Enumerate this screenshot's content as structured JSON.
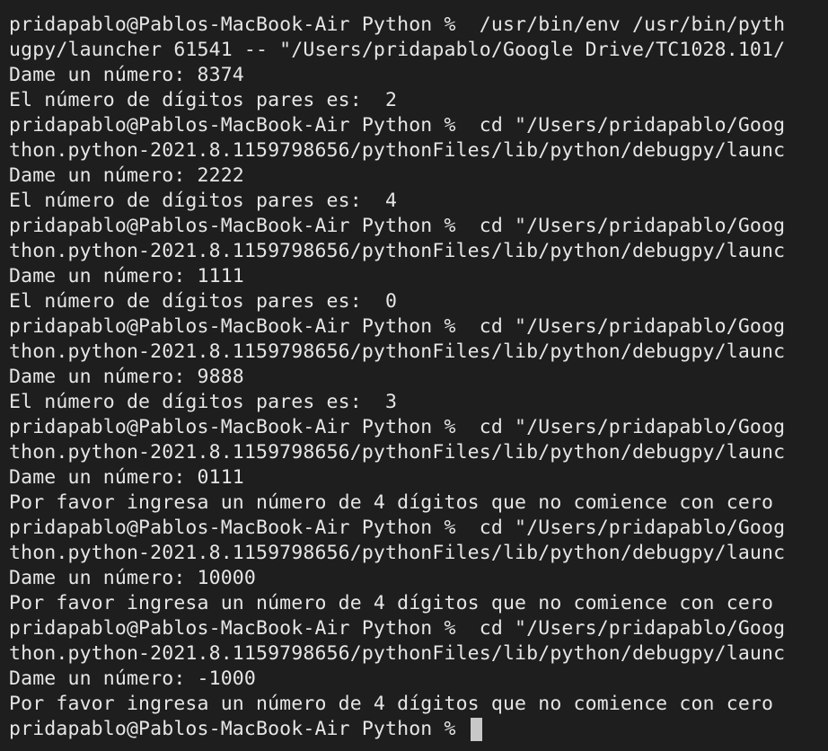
{
  "terminal": {
    "lines": [
      "pridapablo@Pablos-MacBook-Air Python %  /usr/bin/env /usr/bin/pyth",
      "ugpy/launcher 61541 -- \"/Users/pridapablo/Google Drive/TC1028.101/",
      "Dame un número: 8374",
      "El número de dígitos pares es:  2",
      "pridapablo@Pablos-MacBook-Air Python %  cd \"/Users/pridapablo/Goog",
      "thon.python-2021.8.1159798656/pythonFiles/lib/python/debugpy/launc",
      "Dame un número: 2222",
      "El número de dígitos pares es:  4",
      "pridapablo@Pablos-MacBook-Air Python %  cd \"/Users/pridapablo/Goog",
      "thon.python-2021.8.1159798656/pythonFiles/lib/python/debugpy/launc",
      "Dame un número: 1111",
      "El número de dígitos pares es:  0",
      "pridapablo@Pablos-MacBook-Air Python %  cd \"/Users/pridapablo/Goog",
      "thon.python-2021.8.1159798656/pythonFiles/lib/python/debugpy/launc",
      "Dame un número: 9888",
      "El número de dígitos pares es:  3",
      "pridapablo@Pablos-MacBook-Air Python %  cd \"/Users/pridapablo/Goog",
      "thon.python-2021.8.1159798656/pythonFiles/lib/python/debugpy/launc",
      "Dame un número: 0111",
      "Por favor ingresa un número de 4 dígitos que no comience con cero",
      "pridapablo@Pablos-MacBook-Air Python %  cd \"/Users/pridapablo/Goog",
      "thon.python-2021.8.1159798656/pythonFiles/lib/python/debugpy/launc",
      "Dame un número: 10000",
      "Por favor ingresa un número de 4 dígitos que no comience con cero",
      "pridapablo@Pablos-MacBook-Air Python %  cd \"/Users/pridapablo/Goog",
      "thon.python-2021.8.1159798656/pythonFiles/lib/python/debugpy/launc",
      "Dame un número: -1000",
      "Por favor ingresa un número de 4 dígitos que no comience con cero"
    ],
    "prompt": "pridapablo@Pablos-MacBook-Air Python % ",
    "colors": {
      "background": "#1e1e1e",
      "text": "#e6e6e6",
      "cursor": "#c8c8c8"
    }
  }
}
